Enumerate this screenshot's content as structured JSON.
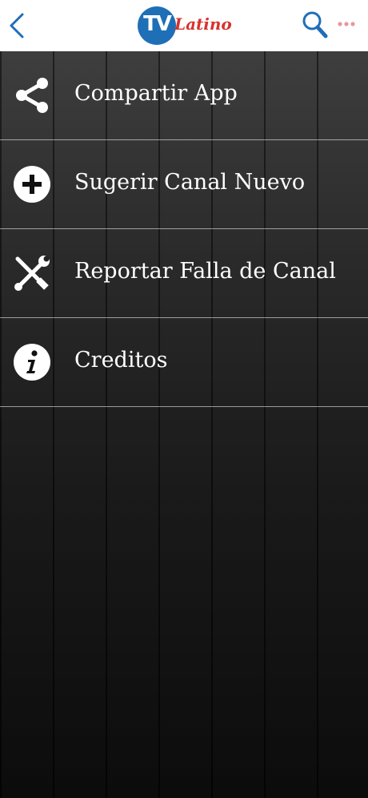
{
  "header": {
    "back_icon": "chevron-left-icon",
    "logo_badge": "TV",
    "logo_word": "Latino",
    "search_icon": "search-icon",
    "more_icon": "more-dots-icon",
    "colors": {
      "accent": "#1f6fb7",
      "brand_red": "#d7322d",
      "bar": "#ffffff"
    }
  },
  "menu": {
    "items": [
      {
        "label": "Compartir App",
        "icon": "share-icon"
      },
      {
        "label": "Sugerir Canal Nuevo",
        "icon": "plus-circle-icon"
      },
      {
        "label": "Reportar Falla de Canal",
        "icon": "tools-icon"
      },
      {
        "label": "Creditos",
        "icon": "info-icon"
      }
    ]
  }
}
